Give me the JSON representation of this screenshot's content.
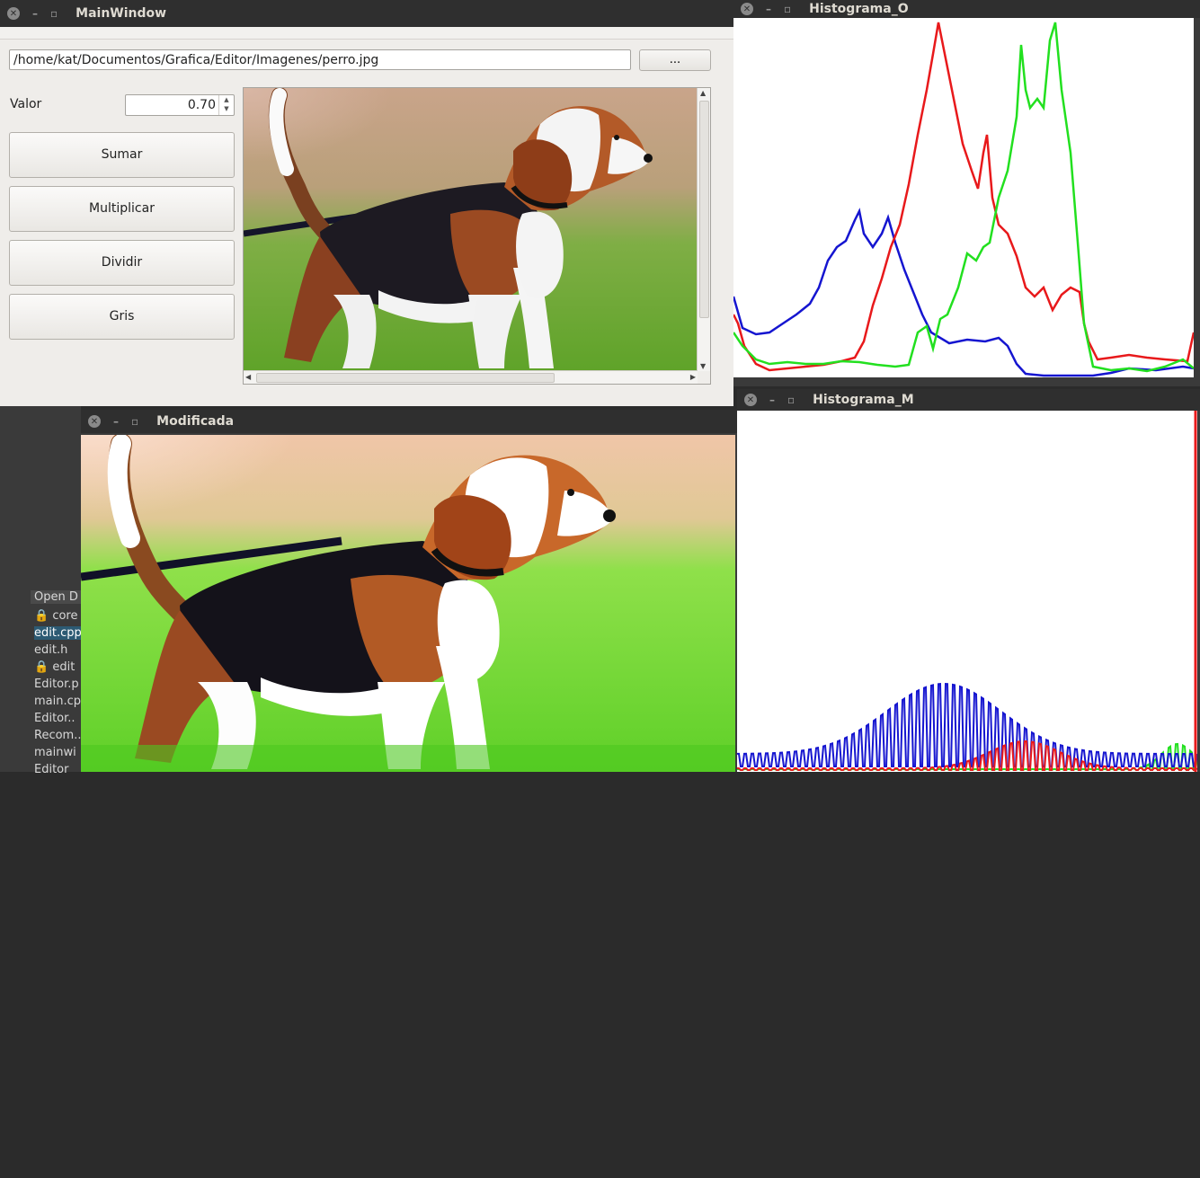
{
  "main_window": {
    "title": "MainWindow",
    "path_value": "/home/kat/Documentos/Grafica/Editor/Imagenes/perro.jpg",
    "browse_label": "...",
    "valor_label": "Valor",
    "valor_value": "0.70",
    "buttons": [
      "Sumar",
      "Multiplicar",
      "Dividir",
      "Gris"
    ]
  },
  "histogram_original": {
    "title": "Histograma_O"
  },
  "histogram_modified": {
    "title": "Histograma_M"
  },
  "modified_window": {
    "title": "Modificada"
  },
  "ide_panel": {
    "header": "Open D",
    "files": [
      "core",
      "edit.cpp",
      "edit.h",
      "edit",
      "Editor.p",
      "main.cp",
      "Editor..",
      "Recom..",
      "mainwi",
      "Editor"
    ],
    "locked": [
      true,
      false,
      false,
      true,
      false,
      false,
      false,
      false,
      false,
      false
    ],
    "selected_index": 1
  },
  "colors": {
    "red": "#e8191b",
    "green": "#22e01f",
    "blue": "#1515d0"
  }
}
